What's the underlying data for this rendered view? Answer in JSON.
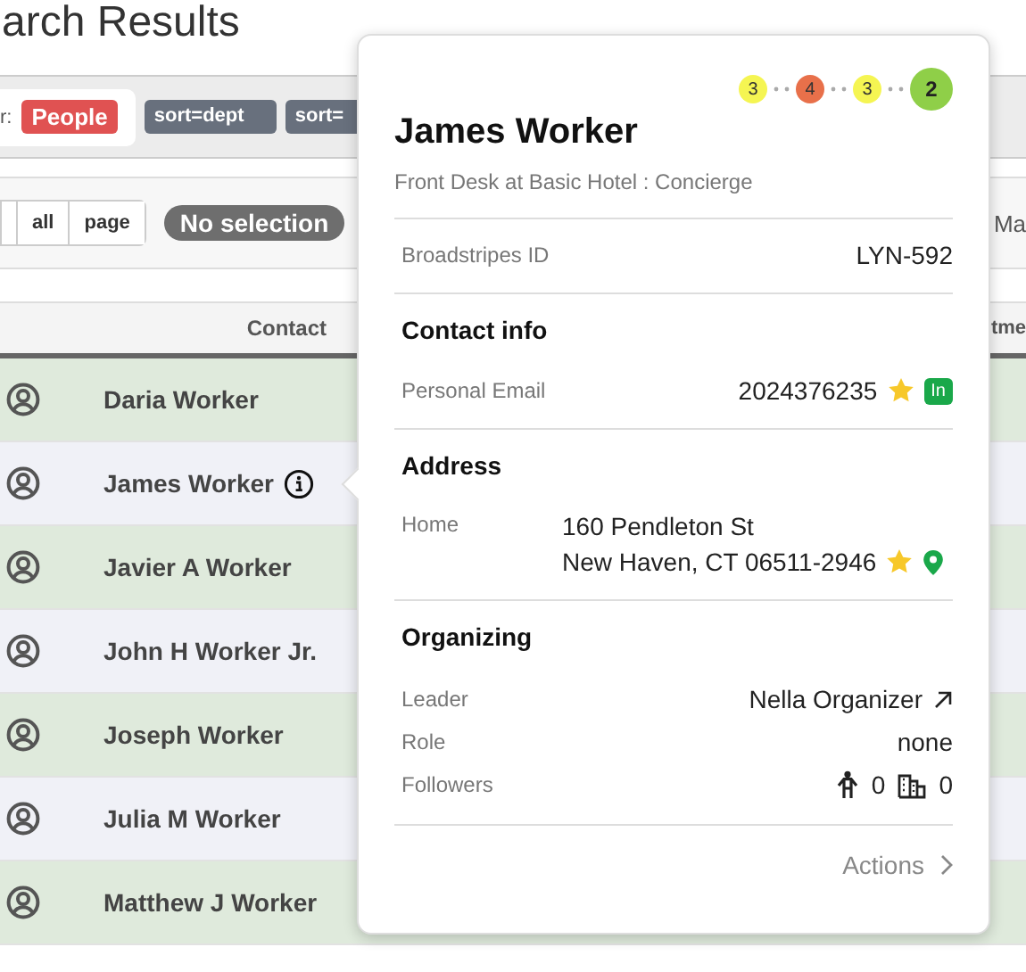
{
  "page_title": "arch Results",
  "filters": {
    "label": "r:",
    "type_badge": "People",
    "tags": [
      "sort=dept",
      "sort="
    ]
  },
  "toolbar": {
    "buttons": [
      "all",
      "page"
    ],
    "selection": "No selection",
    "column_cut": "Ma"
  },
  "table": {
    "columns": [
      "Contact",
      "tme"
    ],
    "rows": [
      {
        "name": "Daria Worker",
        "info": false,
        "highlighted": true
      },
      {
        "name": "James Worker",
        "info": true,
        "highlighted": false
      },
      {
        "name": "Javier A Worker",
        "info": false,
        "highlighted": true
      },
      {
        "name": "John H Worker Jr.",
        "info": false,
        "highlighted": false
      },
      {
        "name": "Joseph Worker",
        "info": false,
        "highlighted": true
      },
      {
        "name": "Julia M Worker",
        "info": false,
        "highlighted": false
      },
      {
        "name": "Matthew J Worker",
        "info": false,
        "highlighted": true
      }
    ]
  },
  "popover": {
    "scores": [
      {
        "value": "3",
        "color": "#f5f552",
        "current": false
      },
      {
        "value": "4",
        "color": "#e8704a",
        "current": false
      },
      {
        "value": "3",
        "color": "#f5f552",
        "current": false
      },
      {
        "value": "2",
        "color": "#8fcf48",
        "current": true
      }
    ],
    "name": "James Worker",
    "subtitle": "Front Desk at Basic Hotel : Concierge",
    "id_label": "Broadstripes ID",
    "id_value": "LYN-592",
    "sections": [
      {
        "title": "Contact info",
        "fields": [
          {
            "label": "Personal Email",
            "lines": [
              "2024376235"
            ],
            "starred": true,
            "badge": "In",
            "pin": false
          }
        ]
      },
      {
        "title": "Address",
        "fields": [
          {
            "label": "Home",
            "lines": [
              "160 Pendleton St",
              "New Haven, CT 06511-2946"
            ],
            "starred": true,
            "pin": true
          }
        ]
      }
    ],
    "organizing": {
      "title": "Organizing",
      "leader_label": "Leader",
      "leader": "Nella Organizer",
      "role_label": "Role",
      "role": "none",
      "followers_label": "Followers",
      "people_count": "0",
      "building_count": "0"
    },
    "actions": "Actions"
  }
}
